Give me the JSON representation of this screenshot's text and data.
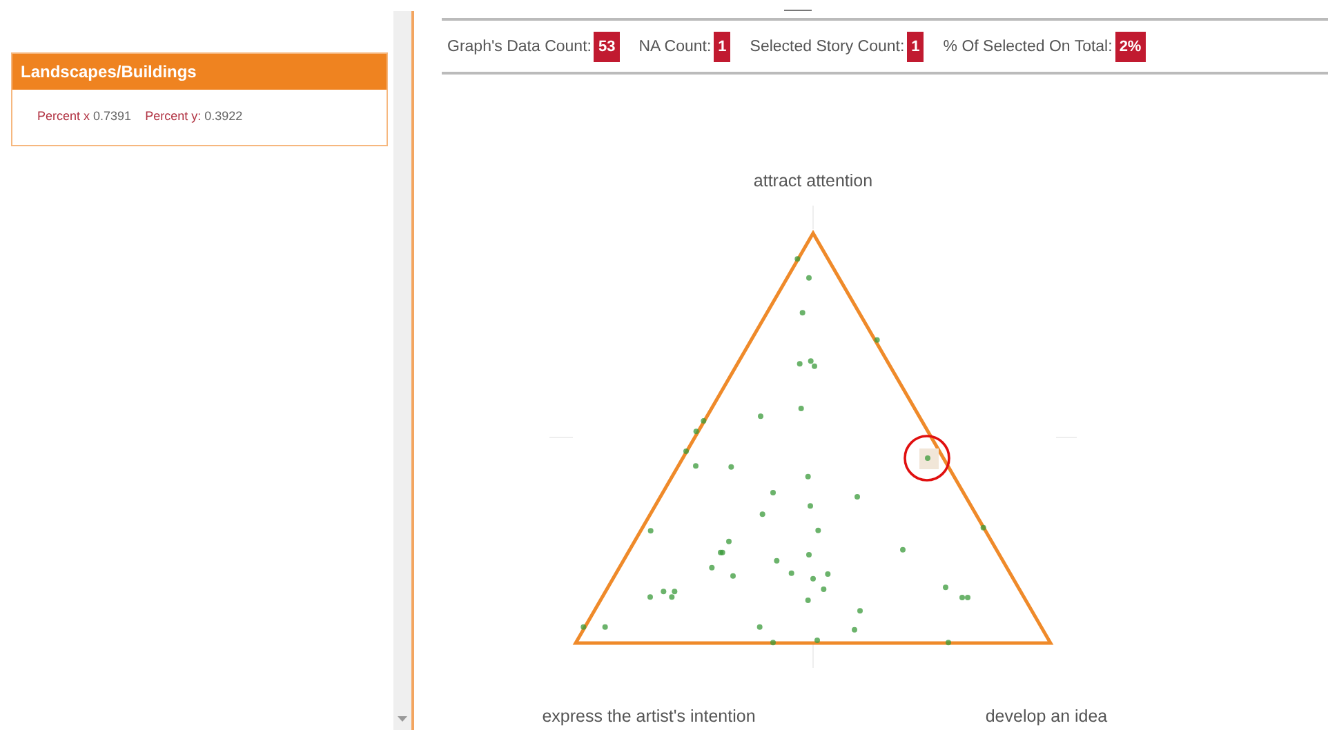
{
  "card": {
    "title": "Landscapes/Buildings",
    "fields": [
      {
        "label": "Percent x",
        "value": "0.7391"
      },
      {
        "label": "Percent y:",
        "value": "0.3922"
      }
    ]
  },
  "stats": [
    {
      "label": "Graph's Data Count:",
      "value": "53"
    },
    {
      "label": "NA Count:",
      "value": "1"
    },
    {
      "label": "Selected Story Count:",
      "value": "1"
    },
    {
      "label": "% Of Selected On Total:",
      "value": "2%"
    }
  ],
  "plot": {
    "top_label": "attract attention",
    "left_label": "express the artist's intention",
    "right_label": "develop an idea"
  }
}
